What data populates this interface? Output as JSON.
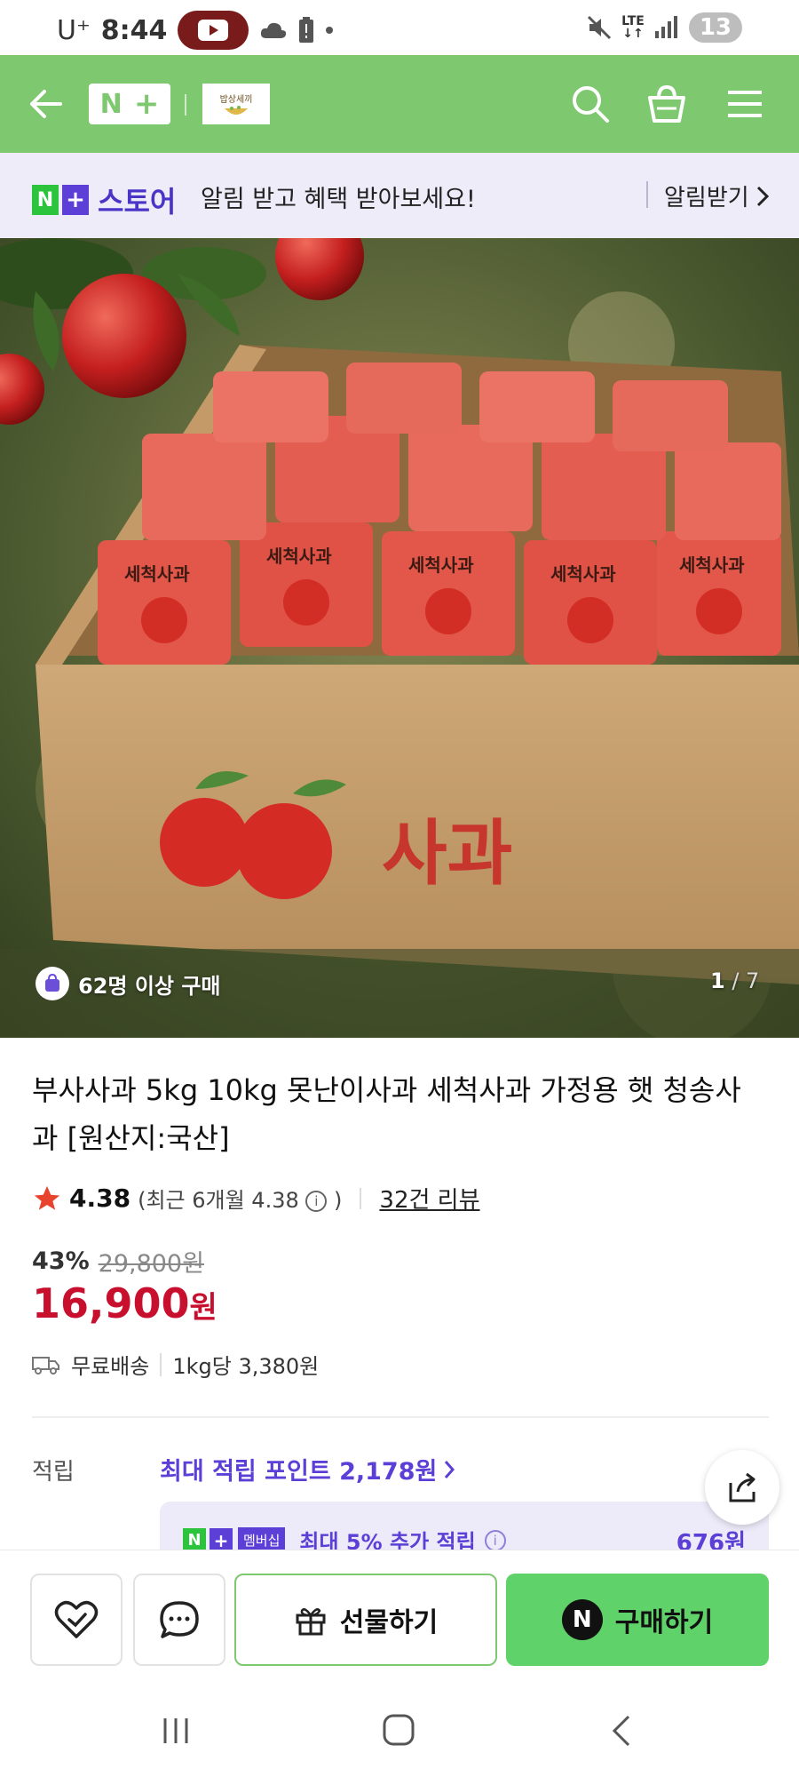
{
  "status_bar": {
    "carrier": "U⁺",
    "time": "8:44",
    "lte": "LTE",
    "notification_count": "13"
  },
  "header": {
    "logo_n": "N",
    "logo_plus": "+",
    "store_logo_text": "밥상세끼",
    "icons": [
      "back-arrow-icon",
      "search-icon",
      "cart-icon",
      "menu-icon"
    ]
  },
  "notice": {
    "badge_n": "N",
    "badge_plus": "+",
    "badge_store": "스토어",
    "text": "알림 받고 혜택 받아보세요!",
    "link_label": "알림받기"
  },
  "product_image": {
    "box_label": "사과",
    "pack_label": "세척사과",
    "purchase_badge": "62명 이상 구매",
    "page_current": "1",
    "page_total": "/ 7"
  },
  "product": {
    "title": "부사사과 5kg 10kg 못난이사과 세척사과 가정용 햇 청송사과 [원산지:국산]",
    "rating": "4.38",
    "rating_recent": "(최근 6개월 4.38",
    "rating_recent_close": ")",
    "review_link": "32건 리뷰",
    "discount": "43%",
    "original_price": "29,800원",
    "sale_price": "16,900",
    "sale_currency": "원",
    "shipping": "무료배송",
    "unit_price": "1kg당 3,380원"
  },
  "points": {
    "label": "적립",
    "link": "최대 적립 포인트 2,178원",
    "membership_n": "N",
    "membership_plus": "+",
    "membership_label": "멤버십",
    "membership_text": "최대 5% 추가 적립",
    "membership_amount": "676원"
  },
  "actions": {
    "gift_label": "선물하기",
    "buy_badge": "N",
    "buy_label": "구매하기"
  },
  "colors": {
    "header_green": "#7ec870",
    "price_red": "#c8102e",
    "purple": "#5b3fd6",
    "buy_green": "#5fd36a"
  }
}
